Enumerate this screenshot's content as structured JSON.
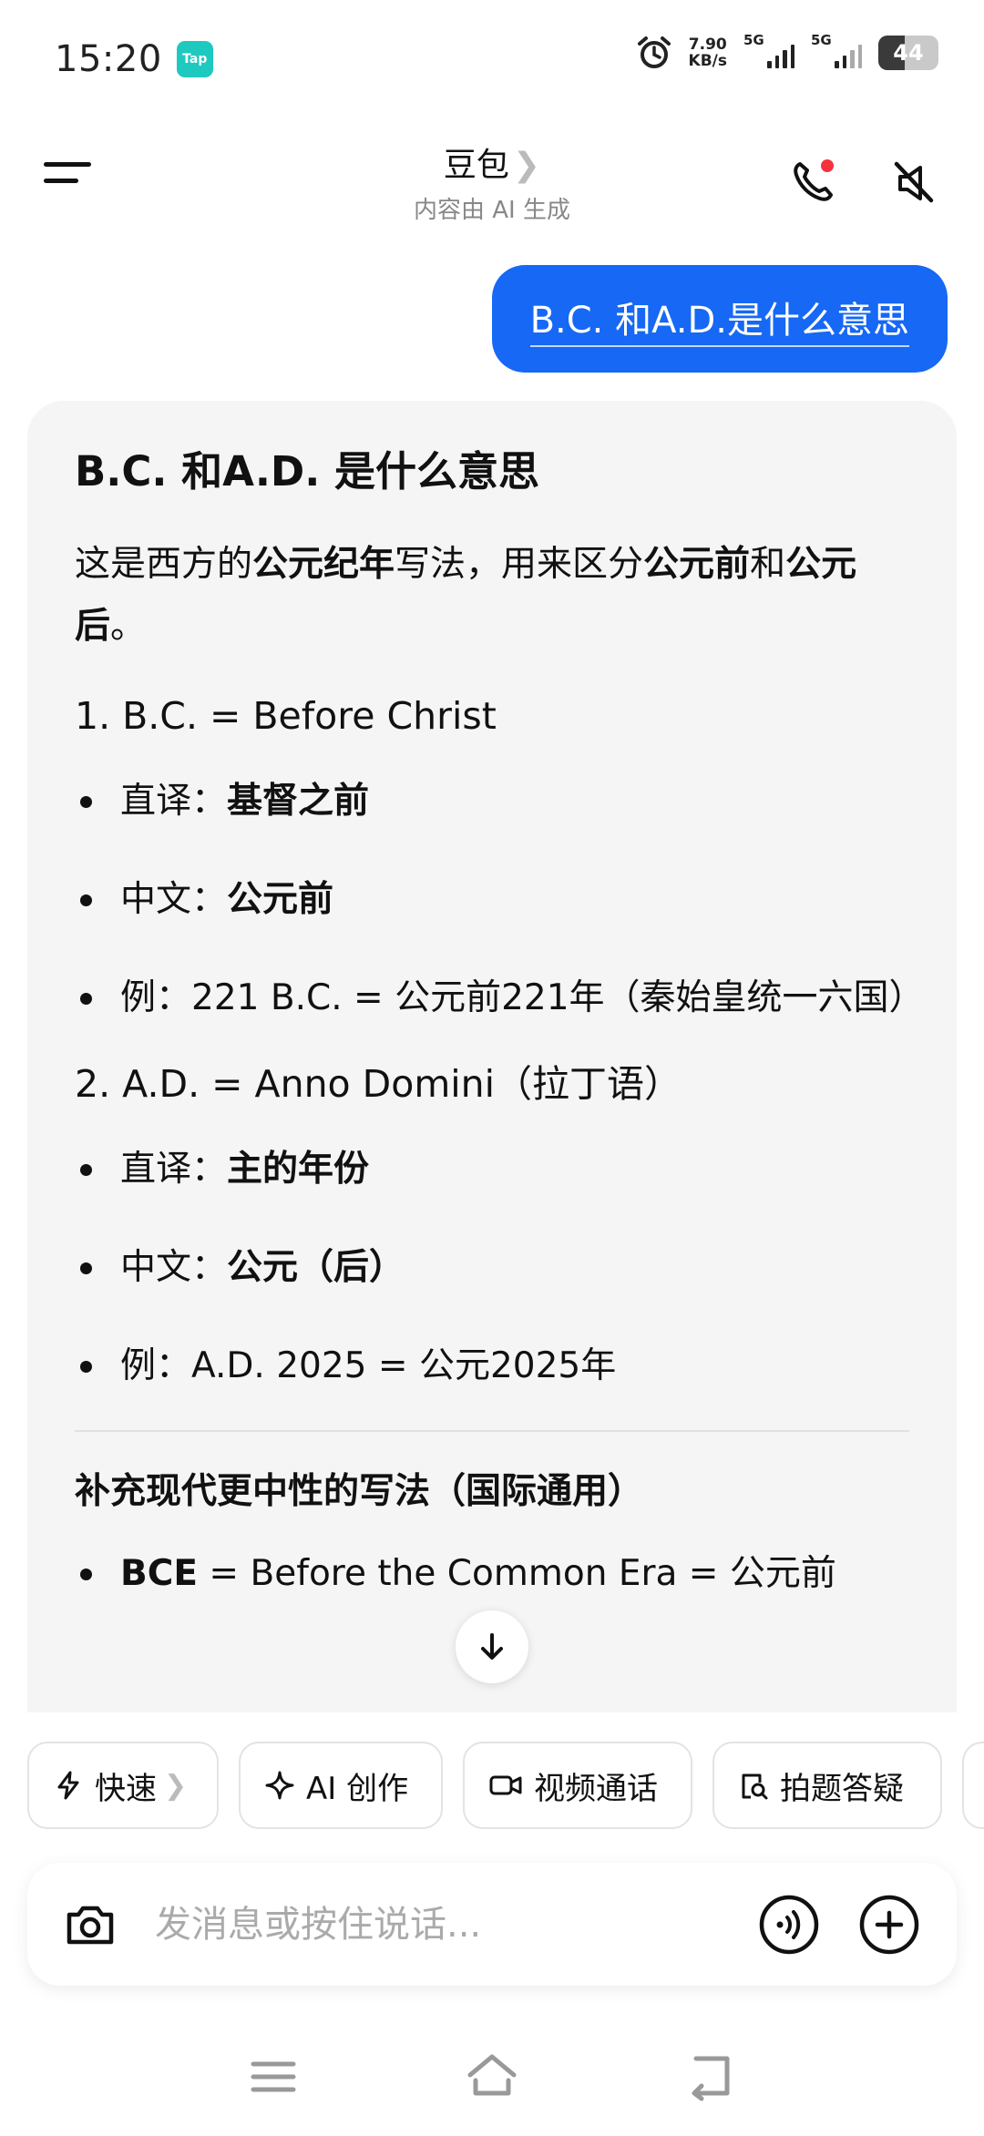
{
  "status_bar": {
    "time": "15:20",
    "app_badge": "Tap",
    "net_speed_value": "7.90",
    "net_speed_unit": "KB/s",
    "sim1_label": "5G",
    "sim2_label": "5G",
    "battery_level": "44"
  },
  "header": {
    "title": "豆包",
    "title_chevron": "❯",
    "subtitle": "内容由 AI 生成",
    "call_icon": "phone-icon",
    "mute_icon": "speaker-muted-icon",
    "notification_dot_color": "#f5333f"
  },
  "chat": {
    "user_message": "B.C. 和A.D.是什么意思",
    "answer": {
      "title": "B.C. 和A.D. 是什么意思",
      "intro_1": "这是西方的",
      "intro_bold_1": "公元纪年",
      "intro_2": "写法，用来区分",
      "intro_bold_2": "公元前",
      "intro_3": "和",
      "intro_bold_3": "公元后",
      "intro_4": "。",
      "section1": {
        "heading": "1. B.C. = Before Christ",
        "b1_label": "直译：",
        "b1_value": "基督之前",
        "b2_label": "中文：",
        "b2_value": "公元前",
        "b3_text": "例：221 B.C. = 公元前221年（秦始皇统一六国）"
      },
      "section2": {
        "heading": "2. A.D. = Anno Domini（拉丁语）",
        "b1_label": "直译：",
        "b1_value": "主的年份",
        "b2_label": "中文：",
        "b2_value": "公元（后）",
        "b3_text": "例：A.D. 2025 = 公元2025年"
      },
      "supplement": {
        "heading": "补充现代更中性的写法（国际通用）",
        "b1_bold": "BCE",
        "b1_text": " = Before the Common Era = 公元前"
      }
    }
  },
  "quick_actions": [
    {
      "label": "快速",
      "icon": "lightning-icon",
      "chevron": "❯"
    },
    {
      "label": "AI 创作",
      "icon": "sparkle-icon"
    },
    {
      "label": "视频通话",
      "icon": "video-camera-icon"
    },
    {
      "label": "拍题答疑",
      "icon": "document-search-icon"
    }
  ],
  "input": {
    "placeholder": "发消息或按住说话...",
    "camera_icon": "camera-icon",
    "voice_icon": "voice-wave-icon",
    "plus_icon": "plus-circle-icon"
  },
  "nav": {
    "menu_icon": "menu-icon",
    "home_icon": "home-icon",
    "back_icon": "back-icon"
  },
  "colors": {
    "accent": "#1668f5",
    "card_bg": "#f5f5f5",
    "tap_badge": "#1ec9c0"
  }
}
